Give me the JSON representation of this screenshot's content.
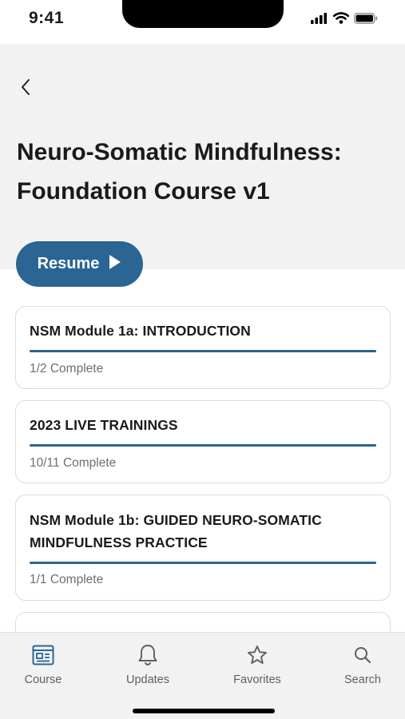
{
  "status_bar": {
    "time": "9:41",
    "icons": [
      "signal-icon",
      "wifi-icon",
      "battery-icon"
    ]
  },
  "header": {
    "back_icon": "chevron-left-icon",
    "title": "Neuro-Somatic Mindfulness: Foundation Course v1"
  },
  "resume_button": {
    "label": "Resume",
    "icon": "play-icon"
  },
  "modules": [
    {
      "title": "NSM Module 1a: INTRODUCTION",
      "status": "1/2 Complete",
      "progress": 1.0
    },
    {
      "title": "2023 LIVE TRAININGS",
      "status": "10/11 Complete",
      "progress": 1.0
    },
    {
      "title": "NSM Module 1b: GUIDED NEURO-SOMATIC MINDFULNESS PRACTICE",
      "status": "1/1 Complete",
      "progress": 1.0
    }
  ],
  "tab_bar": {
    "tabs": [
      {
        "label": "Course",
        "icon": "course-icon",
        "active": true
      },
      {
        "label": "Updates",
        "icon": "bell-icon",
        "active": false
      },
      {
        "label": "Favorites",
        "icon": "star-icon",
        "active": false
      },
      {
        "label": "Search",
        "icon": "search-icon",
        "active": false
      }
    ]
  },
  "colors": {
    "accent": "#2a6593",
    "header_bg": "#f2f2f2",
    "card_border": "#dcdcdc",
    "muted_text": "#6e6e6e"
  }
}
